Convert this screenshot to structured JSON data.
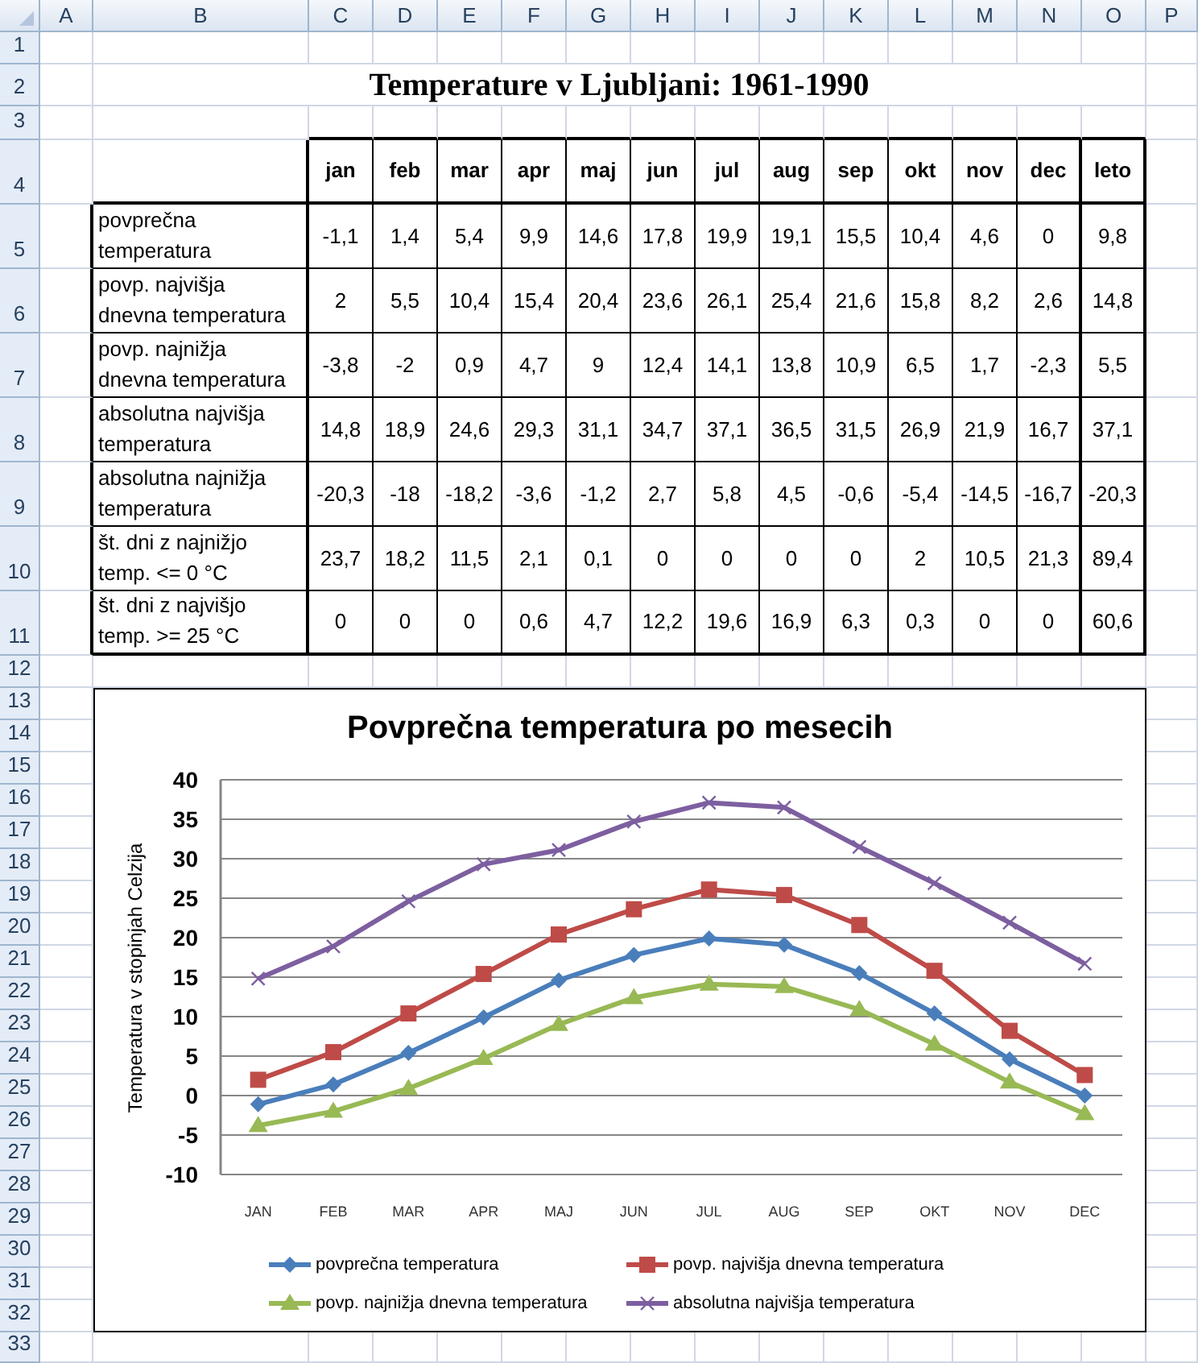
{
  "sheet": {
    "columns": [
      "A",
      "B",
      "C",
      "D",
      "E",
      "F",
      "G",
      "H",
      "I",
      "J",
      "K",
      "L",
      "M",
      "N",
      "O",
      "P"
    ],
    "rows": [
      "1",
      "2",
      "3",
      "4",
      "5",
      "6",
      "7",
      "8",
      "9",
      "10",
      "11",
      "12",
      "13",
      "14",
      "15",
      "16",
      "17",
      "18",
      "19",
      "20",
      "21",
      "22",
      "23",
      "24",
      "25",
      "26",
      "27",
      "28",
      "29",
      "30",
      "31",
      "32",
      "33"
    ]
  },
  "title": "Temperature v Ljubljani: 1961-1990",
  "table": {
    "columns": [
      "jan",
      "feb",
      "mar",
      "apr",
      "maj",
      "jun",
      "jul",
      "aug",
      "sep",
      "okt",
      "nov",
      "dec",
      "leto"
    ],
    "rows": [
      {
        "label": "povprečna\ntemperatura",
        "values": [
          "-1,1",
          "1,4",
          "5,4",
          "9,9",
          "14,6",
          "17,8",
          "19,9",
          "19,1",
          "15,5",
          "10,4",
          "4,6",
          "0",
          "9,8"
        ]
      },
      {
        "label": "povp. najvišja\ndnevna temperatura",
        "values": [
          "2",
          "5,5",
          "10,4",
          "15,4",
          "20,4",
          "23,6",
          "26,1",
          "25,4",
          "21,6",
          "15,8",
          "8,2",
          "2,6",
          "14,8"
        ]
      },
      {
        "label": "povp. najnižja\ndnevna temperatura",
        "values": [
          "-3,8",
          "-2",
          "0,9",
          "4,7",
          "9",
          "12,4",
          "14,1",
          "13,8",
          "10,9",
          "6,5",
          "1,7",
          "-2,3",
          "5,5"
        ]
      },
      {
        "label": "absolutna najvišja\ntemperatura",
        "values": [
          "14,8",
          "18,9",
          "24,6",
          "29,3",
          "31,1",
          "34,7",
          "37,1",
          "36,5",
          "31,5",
          "26,9",
          "21,9",
          "16,7",
          "37,1"
        ]
      },
      {
        "label": "absolutna najnižja\ntemperatura",
        "values": [
          "-20,3",
          "-18",
          "-18,2",
          "-3,6",
          "-1,2",
          "2,7",
          "5,8",
          "4,5",
          "-0,6",
          "-5,4",
          "-14,5",
          "-16,7",
          "-20,3"
        ]
      },
      {
        "label": "št. dni z najnižjo\ntemp. <= 0 °C",
        "values": [
          "23,7",
          "18,2",
          "11,5",
          "2,1",
          "0,1",
          "0",
          "0",
          "0",
          "0",
          "2",
          "10,5",
          "21,3",
          "89,4"
        ]
      },
      {
        "label": "št. dni z najvišjo\ntemp. >= 25 °C",
        "values": [
          "0",
          "0",
          "0",
          "0,6",
          "4,7",
          "12,2",
          "19,6",
          "16,9",
          "6,3",
          "0,3",
          "0",
          "0",
          "60,6"
        ]
      }
    ]
  },
  "chart": {
    "chart_data": {
      "type": "line",
      "title": "Povprečna temperatura po mesecih",
      "ylabel": "Temperatura v stopinjah Celzija",
      "categories": [
        "JAN",
        "FEB",
        "MAR",
        "APR",
        "MAJ",
        "JUN",
        "JUL",
        "AUG",
        "SEP",
        "OKT",
        "NOV",
        "DEC"
      ],
      "series": [
        {
          "name": "povprečna temperatura",
          "color": "#4a7ebb",
          "marker": "diamond",
          "values": [
            -1.1,
            1.4,
            5.4,
            9.9,
            14.6,
            17.8,
            19.9,
            19.1,
            15.5,
            10.4,
            4.6,
            0
          ]
        },
        {
          "name": "povp. najvišja dnevna temperatura",
          "color": "#be4b48",
          "marker": "square",
          "values": [
            2,
            5.5,
            10.4,
            15.4,
            20.4,
            23.6,
            26.1,
            25.4,
            21.6,
            15.8,
            8.2,
            2.6
          ]
        },
        {
          "name": "povp. najnižja dnevna temperatura",
          "color": "#98b954",
          "marker": "triangle",
          "values": [
            -3.8,
            -2,
            0.9,
            4.7,
            9,
            12.4,
            14.1,
            13.8,
            10.9,
            6.5,
            1.7,
            -2.3
          ]
        },
        {
          "name": "absolutna najvišja temperatura",
          "color": "#7d5fa0",
          "marker": "x",
          "values": [
            14.8,
            18.9,
            24.6,
            29.3,
            31.1,
            34.7,
            37.1,
            36.5,
            31.5,
            26.9,
            21.9,
            16.7
          ]
        }
      ],
      "ylim": [
        -10,
        40
      ],
      "yticks": [
        -10,
        -5,
        0,
        5,
        10,
        15,
        20,
        25,
        30,
        35,
        40
      ],
      "grid": true,
      "legend": "bottom"
    }
  }
}
